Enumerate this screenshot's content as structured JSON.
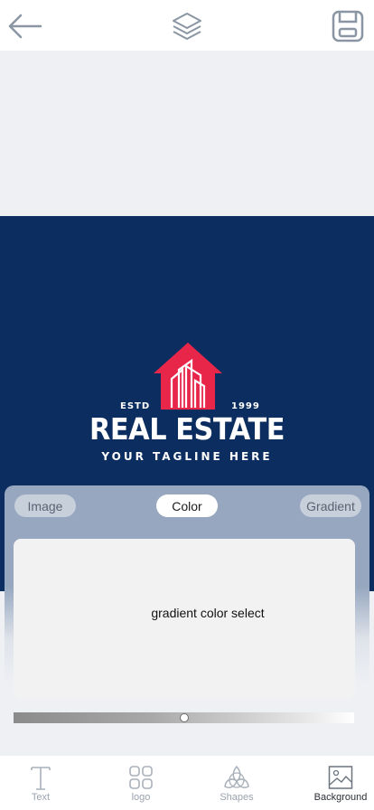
{
  "toolbar": {
    "back_icon": "arrow-left-icon",
    "layers_icon": "layers-icon",
    "save_icon": "floppy-disk-icon",
    "icon_color": "#8a96a3"
  },
  "design": {
    "background_color": "#0b2d5f",
    "accent_color": "#e8264a",
    "estd": "ESTD",
    "year": "1999",
    "brand": "REAL ESTATE",
    "tagline": "YOUR TAGLINE HERE"
  },
  "background_panel": {
    "tabs": [
      {
        "label": "Image",
        "selected": false
      },
      {
        "label": "Color",
        "selected": true
      },
      {
        "label": "Gradient",
        "selected": false
      }
    ],
    "picker_label": "gradient color select",
    "slider_value": 0.5
  },
  "bottom_nav": {
    "items": [
      {
        "label": "Text",
        "icon": "text-icon",
        "active": false
      },
      {
        "label": "logo",
        "icon": "logo-grid-icon",
        "active": false
      },
      {
        "label": "Shapes",
        "icon": "shapes-icon",
        "active": false
      },
      {
        "label": "Background",
        "icon": "image-icon",
        "active": true
      }
    ]
  }
}
